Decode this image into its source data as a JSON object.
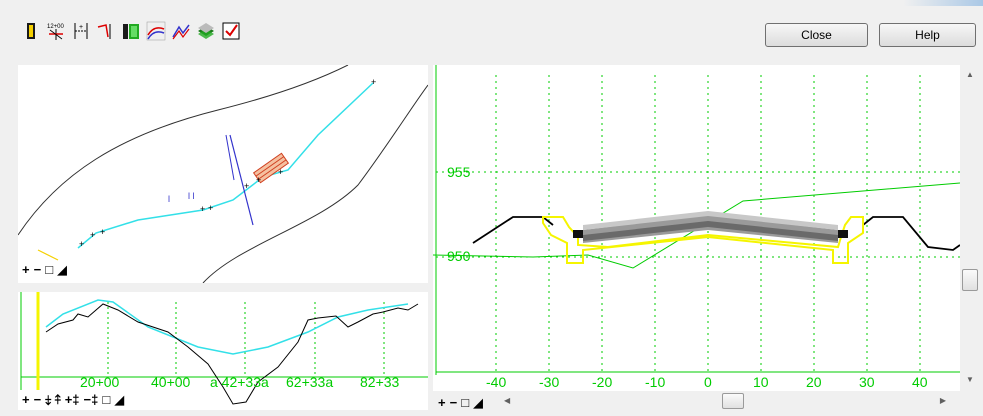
{
  "toolbar": {
    "icons": [
      "alignment-icon",
      "station-icon",
      "offset-icon",
      "profile-icon",
      "template-icon",
      "surface-icon",
      "superelevation-icon",
      "layers-icon",
      "check-icon"
    ]
  },
  "buttons": {
    "close": "Close",
    "help": "Help"
  },
  "plan_tools": [
    "+",
    "−",
    "□",
    "◢"
  ],
  "profile_panel": {
    "station_labels": [
      "20+00",
      "40+00",
      "a 42+33a",
      "62+33a",
      "82+33"
    ],
    "tools": [
      "+",
      "−",
      "⤈",
      "⤉",
      "+‡",
      "−‡",
      "□",
      "◢"
    ]
  },
  "section_panel": {
    "elevation_labels": [
      "955",
      "950"
    ],
    "offset_labels": [
      "-40",
      "-30",
      "-20",
      "-10",
      "0",
      "10",
      "20",
      "30",
      "40"
    ],
    "tools": [
      "+",
      "−",
      "□",
      "◢"
    ]
  },
  "colors": {
    "accent_green": "#00cc00",
    "cyan": "#33e0e8",
    "yellow": "#f5f500",
    "alignment_blue": "#3333cc"
  }
}
